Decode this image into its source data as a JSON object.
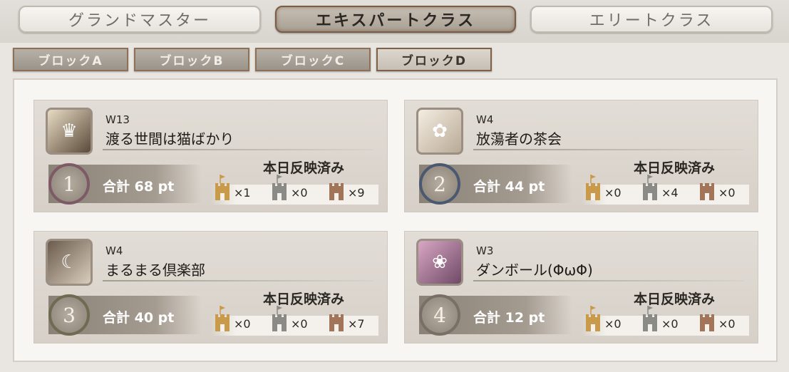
{
  "top_tabs": [
    "グランドマスター",
    "エキスパートクラス",
    "エリートクラス"
  ],
  "active_top_tab": "エキスパートクラス",
  "blocks": [
    "ブロックA",
    "ブロックB",
    "ブロックC",
    "ブロックD"
  ],
  "active_block": "ブロックD",
  "status_label": "本日反映済み",
  "cards": [
    {
      "week": "W13",
      "name": "渡る世間は猫ばかり",
      "rank": "1",
      "points": "合計 68 pt",
      "gold": "×1",
      "silver": "×0",
      "bronze": "×9"
    },
    {
      "week": "W4",
      "name": "放蕩者の茶会",
      "rank": "2",
      "points": "合計 44 pt",
      "gold": "×0",
      "silver": "×4",
      "bronze": "×0"
    },
    {
      "week": "W4",
      "name": "まるまる倶楽部",
      "rank": "3",
      "points": "合計 40 pt",
      "gold": "×0",
      "silver": "×0",
      "bronze": "×7"
    },
    {
      "week": "W3",
      "name": "ダンボール(ΦωΦ)",
      "rank": "4",
      "points": "合計 12 pt",
      "gold": "×0",
      "silver": "×0",
      "bronze": "×0"
    }
  ],
  "colors": {
    "gold": "#c99a4a",
    "silver": "#8a8a86",
    "bronze": "#a27559",
    "rank1": "#7d5a66",
    "rank2": "#4a5870",
    "rank3": "#6f6a52",
    "rank4": "#7a6f67"
  },
  "icons": {
    "castle": "castle-icon",
    "avatar": "guild-avatar"
  }
}
